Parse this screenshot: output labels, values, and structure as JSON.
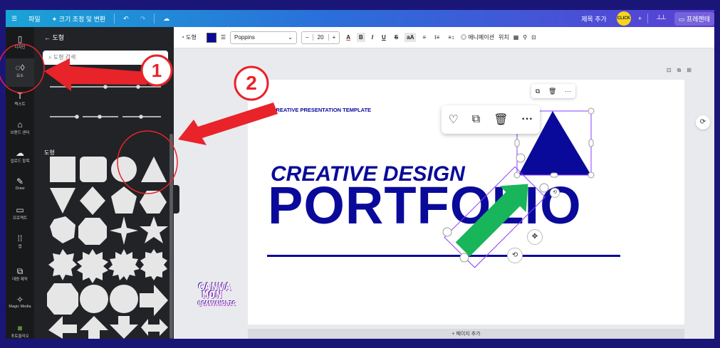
{
  "topbar": {
    "menu_icon": "hamburger-icon",
    "file": "파일",
    "resize": "✦ 크기 조정 및 변환",
    "undo_icon": "undo-icon",
    "redo_icon": "redo-icon",
    "cloud_icon": "cloud-sync-icon",
    "add_title": "제목 추가",
    "avatar_text": "CLICK",
    "plus": "+",
    "present": "프레젠테"
  },
  "rail": {
    "items": [
      {
        "label": "디자인",
        "icon": "▯"
      },
      {
        "label": "요소",
        "icon": "◌◊"
      },
      {
        "label": "텍스트",
        "icon": "T"
      },
      {
        "label": "브랜드 센터",
        "icon": "⌂"
      },
      {
        "label": "업로드 항목",
        "icon": "☁"
      },
      {
        "label": "Draw",
        "icon": "✎"
      },
      {
        "label": "프로젝트",
        "icon": "▭"
      },
      {
        "label": "앱",
        "icon": "⁞⁞"
      },
      {
        "label": "대량 제작",
        "icon": "⧉"
      },
      {
        "label": "Magic Media",
        "icon": "✧"
      },
      {
        "label": "포토클리오",
        "icon": "■"
      }
    ]
  },
  "panel": {
    "back_label": "← 도형",
    "search_placeholder": "도형 검색",
    "section": "도형"
  },
  "toolbar": {
    "shape_label": "도형",
    "font": "Poppins",
    "minus": "−",
    "size": "20",
    "plus": "+",
    "text_color": "A",
    "bold": "B",
    "italic": "I",
    "underline": "U",
    "strike": "S",
    "case": "aA",
    "align": "≡",
    "list": "⁝≡",
    "spacing": "≡↕",
    "animate": "애니메이션",
    "position": "위치"
  },
  "canvas": {
    "small_title": "CREATIVE PRESENTATION TEMPLATE",
    "title1": "CREATIVE DESIGN",
    "title2": "PORTFOLIO",
    "add_page": "+ 페이지 추가",
    "accent": "#0a0a9a",
    "arrow_color": "#18b55a"
  },
  "annotations": {
    "num1": "1",
    "num2": "2",
    "arrow_color": "#e8232a"
  },
  "watermark": {
    "line1": "CANVA",
    "line2": "MON",
    "line3": "@CANVAHOLIC"
  }
}
